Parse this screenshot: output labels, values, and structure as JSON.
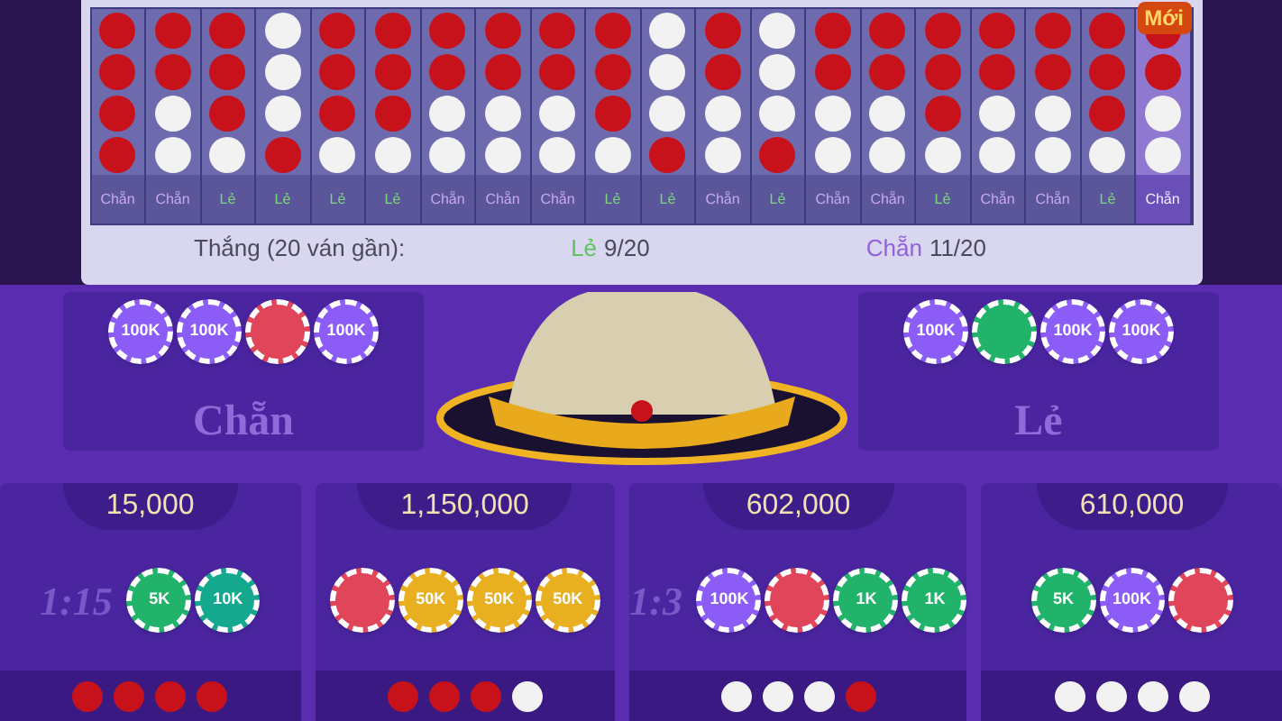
{
  "history": {
    "badge": "Mới",
    "columns": [
      {
        "dots": [
          {
            "red": true
          },
          {
            "red": true
          },
          {
            "red": true
          },
          {
            "red": true
          }
        ],
        "label": "Chẵn",
        "kind": "even",
        "selected": false
      },
      {
        "dots": [
          {
            "red": true
          },
          {
            "red": true
          },
          {
            "red": false
          },
          {
            "red": false
          }
        ],
        "label": "Chẵn",
        "kind": "even",
        "selected": false
      },
      {
        "dots": [
          {
            "red": true
          },
          {
            "red": true
          },
          {
            "red": true
          },
          {
            "red": false
          }
        ],
        "label": "Lẻ",
        "kind": "odd",
        "selected": false
      },
      {
        "dots": [
          {
            "red": false
          },
          {
            "red": false
          },
          {
            "red": false
          },
          {
            "red": true
          }
        ],
        "label": "Lẻ",
        "kind": "odd",
        "selected": false
      },
      {
        "dots": [
          {
            "red": true
          },
          {
            "red": true
          },
          {
            "red": true
          },
          {
            "red": false
          }
        ],
        "label": "Lẻ",
        "kind": "odd",
        "selected": false
      },
      {
        "dots": [
          {
            "red": true
          },
          {
            "red": true
          },
          {
            "red": true
          },
          {
            "red": false
          }
        ],
        "label": "Lẻ",
        "kind": "odd",
        "selected": false
      },
      {
        "dots": [
          {
            "red": true
          },
          {
            "red": true
          },
          {
            "red": false
          },
          {
            "red": false
          }
        ],
        "label": "Chẵn",
        "kind": "even",
        "selected": false
      },
      {
        "dots": [
          {
            "red": true
          },
          {
            "red": true
          },
          {
            "red": false
          },
          {
            "red": false
          }
        ],
        "label": "Chẵn",
        "kind": "even",
        "selected": false
      },
      {
        "dots": [
          {
            "red": true
          },
          {
            "red": true
          },
          {
            "red": false
          },
          {
            "red": false
          }
        ],
        "label": "Chẵn",
        "kind": "even",
        "selected": false
      },
      {
        "dots": [
          {
            "red": true
          },
          {
            "red": true
          },
          {
            "red": true
          },
          {
            "red": false
          }
        ],
        "label": "Lẻ",
        "kind": "odd",
        "selected": false
      },
      {
        "dots": [
          {
            "red": false
          },
          {
            "red": false
          },
          {
            "red": false
          },
          {
            "red": true
          }
        ],
        "label": "Lẻ",
        "kind": "odd",
        "selected": false
      },
      {
        "dots": [
          {
            "red": true
          },
          {
            "red": true
          },
          {
            "red": false
          },
          {
            "red": false
          }
        ],
        "label": "Chẵn",
        "kind": "even",
        "selected": false
      },
      {
        "dots": [
          {
            "red": false
          },
          {
            "red": false
          },
          {
            "red": false
          },
          {
            "red": true
          }
        ],
        "label": "Lẻ",
        "kind": "odd",
        "selected": false
      },
      {
        "dots": [
          {
            "red": true
          },
          {
            "red": true
          },
          {
            "red": false
          },
          {
            "red": false
          }
        ],
        "label": "Chẵn",
        "kind": "even",
        "selected": false
      },
      {
        "dots": [
          {
            "red": true
          },
          {
            "red": true
          },
          {
            "red": false
          },
          {
            "red": false
          }
        ],
        "label": "Chẵn",
        "kind": "even",
        "selected": false
      },
      {
        "dots": [
          {
            "red": true
          },
          {
            "red": true
          },
          {
            "red": true
          },
          {
            "red": false
          }
        ],
        "label": "Lẻ",
        "kind": "odd",
        "selected": false
      },
      {
        "dots": [
          {
            "red": true
          },
          {
            "red": true
          },
          {
            "red": false
          },
          {
            "red": false
          }
        ],
        "label": "Chẵn",
        "kind": "even",
        "selected": false
      },
      {
        "dots": [
          {
            "red": true
          },
          {
            "red": true
          },
          {
            "red": false
          },
          {
            "red": false
          }
        ],
        "label": "Chẵn",
        "kind": "even",
        "selected": false
      },
      {
        "dots": [
          {
            "red": true
          },
          {
            "red": true
          },
          {
            "red": true
          },
          {
            "red": false
          }
        ],
        "label": "Lẻ",
        "kind": "odd",
        "selected": false
      },
      {
        "dots": [
          {
            "red": true
          },
          {
            "red": true
          },
          {
            "red": false
          },
          {
            "red": false
          }
        ],
        "label": "Chẵn",
        "kind": "even",
        "selected": true
      }
    ],
    "summary": {
      "label": "Thắng (20 ván gần):",
      "odd_name": "Lẻ",
      "odd_count": "9/20",
      "even_name": "Chẵn",
      "even_count": "11/20"
    }
  },
  "main_bets": [
    {
      "label": "Chẵn",
      "chips": [
        {
          "label": "100K",
          "color": "#8b5cf6"
        },
        {
          "label": "100K",
          "color": "#8b5cf6"
        },
        {
          "color": "#e0455a"
        },
        {
          "label": "100K",
          "color": "#8b5cf6"
        }
      ]
    },
    {
      "label": "Lẻ",
      "chips": [
        {
          "label": "100K",
          "color": "#8b5cf6"
        },
        {
          "color": "#22b36b"
        },
        {
          "label": "100K",
          "color": "#8b5cf6"
        },
        {
          "label": "100K",
          "color": "#8b5cf6"
        }
      ]
    }
  ],
  "side_bets": [
    {
      "amount": "15,000",
      "odds": "1:15",
      "chips": [
        {
          "label": "5K",
          "color": "#22b36b"
        },
        {
          "label": "10K",
          "color": "#14a98f"
        }
      ],
      "dots": [
        {
          "red": true
        },
        {
          "red": true
        },
        {
          "red": true
        },
        {
          "red": true
        }
      ]
    },
    {
      "amount": "1,150,000",
      "chips": [
        {
          "color": "#e0455a"
        },
        {
          "label": "50K",
          "color": "#e8b021"
        },
        {
          "label": "50K",
          "color": "#e8b021"
        },
        {
          "label": "50K",
          "color": "#e8b021"
        }
      ],
      "dots": [
        {
          "red": true
        },
        {
          "red": true
        },
        {
          "red": true
        },
        {
          "red": false
        }
      ]
    },
    {
      "amount": "602,000",
      "odds": "1:3",
      "chips": [
        {
          "label": "100K",
          "color": "#8b5cf6"
        },
        {
          "color": "#e0455a"
        },
        {
          "label": "1K",
          "color": "#22b36b"
        },
        {
          "label": "1K",
          "color": "#22b36b"
        }
      ],
      "dots": [
        {
          "red": false
        },
        {
          "red": false
        },
        {
          "red": false
        },
        {
          "red": true
        }
      ]
    },
    {
      "amount": "610,000",
      "chips": [
        {
          "label": "5K",
          "color": "#22b36b"
        },
        {
          "label": "100K",
          "color": "#8b5cf6"
        },
        {
          "color": "#e0455a"
        }
      ],
      "dots": [
        {
          "red": false
        },
        {
          "red": false
        },
        {
          "red": false
        },
        {
          "red": false
        }
      ]
    }
  ]
}
